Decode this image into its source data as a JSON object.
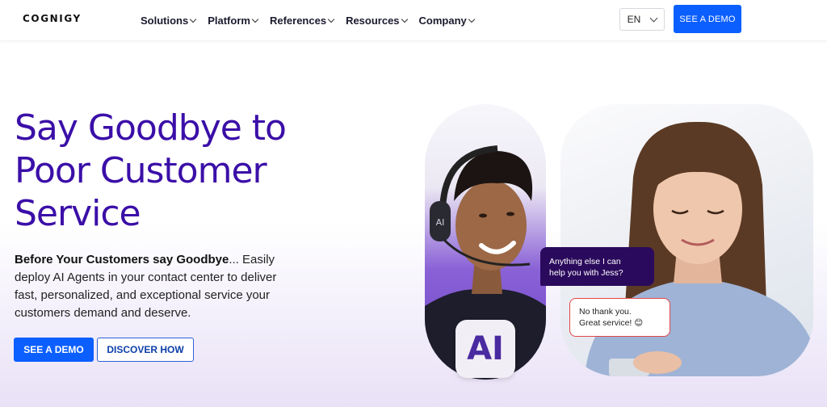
{
  "header": {
    "logo": "COGNIGY",
    "nav": [
      {
        "label": "Solutions"
      },
      {
        "label": "Platform"
      },
      {
        "label": "References"
      },
      {
        "label": "Resources"
      },
      {
        "label": "Company"
      }
    ],
    "language": "EN",
    "demo_label": "SEE A DEMO"
  },
  "hero": {
    "title_line1": "Say Goodbye to",
    "title_line2": "Poor Customer",
    "title_line3": "Service",
    "lead_bold": "Before Your Customers say Goodbye",
    "lead_rest": "... Easily deploy AI Agents in your contact center to deliver fast, personalized, and exceptional service your customers demand and deserve.",
    "primary_cta": "SEE A DEMO",
    "secondary_cta": "DISCOVER HOW"
  },
  "visual": {
    "ai_badge": "AI",
    "bubble_agent_line1": "Anything else I can",
    "bubble_agent_line2": "help you with Jess?",
    "bubble_user_line1": "No thank you.",
    "bubble_user_line2": "Great service! 😊"
  },
  "colors": {
    "brand_purple": "#3b0fa8",
    "cta_blue": "#0b5fff"
  }
}
